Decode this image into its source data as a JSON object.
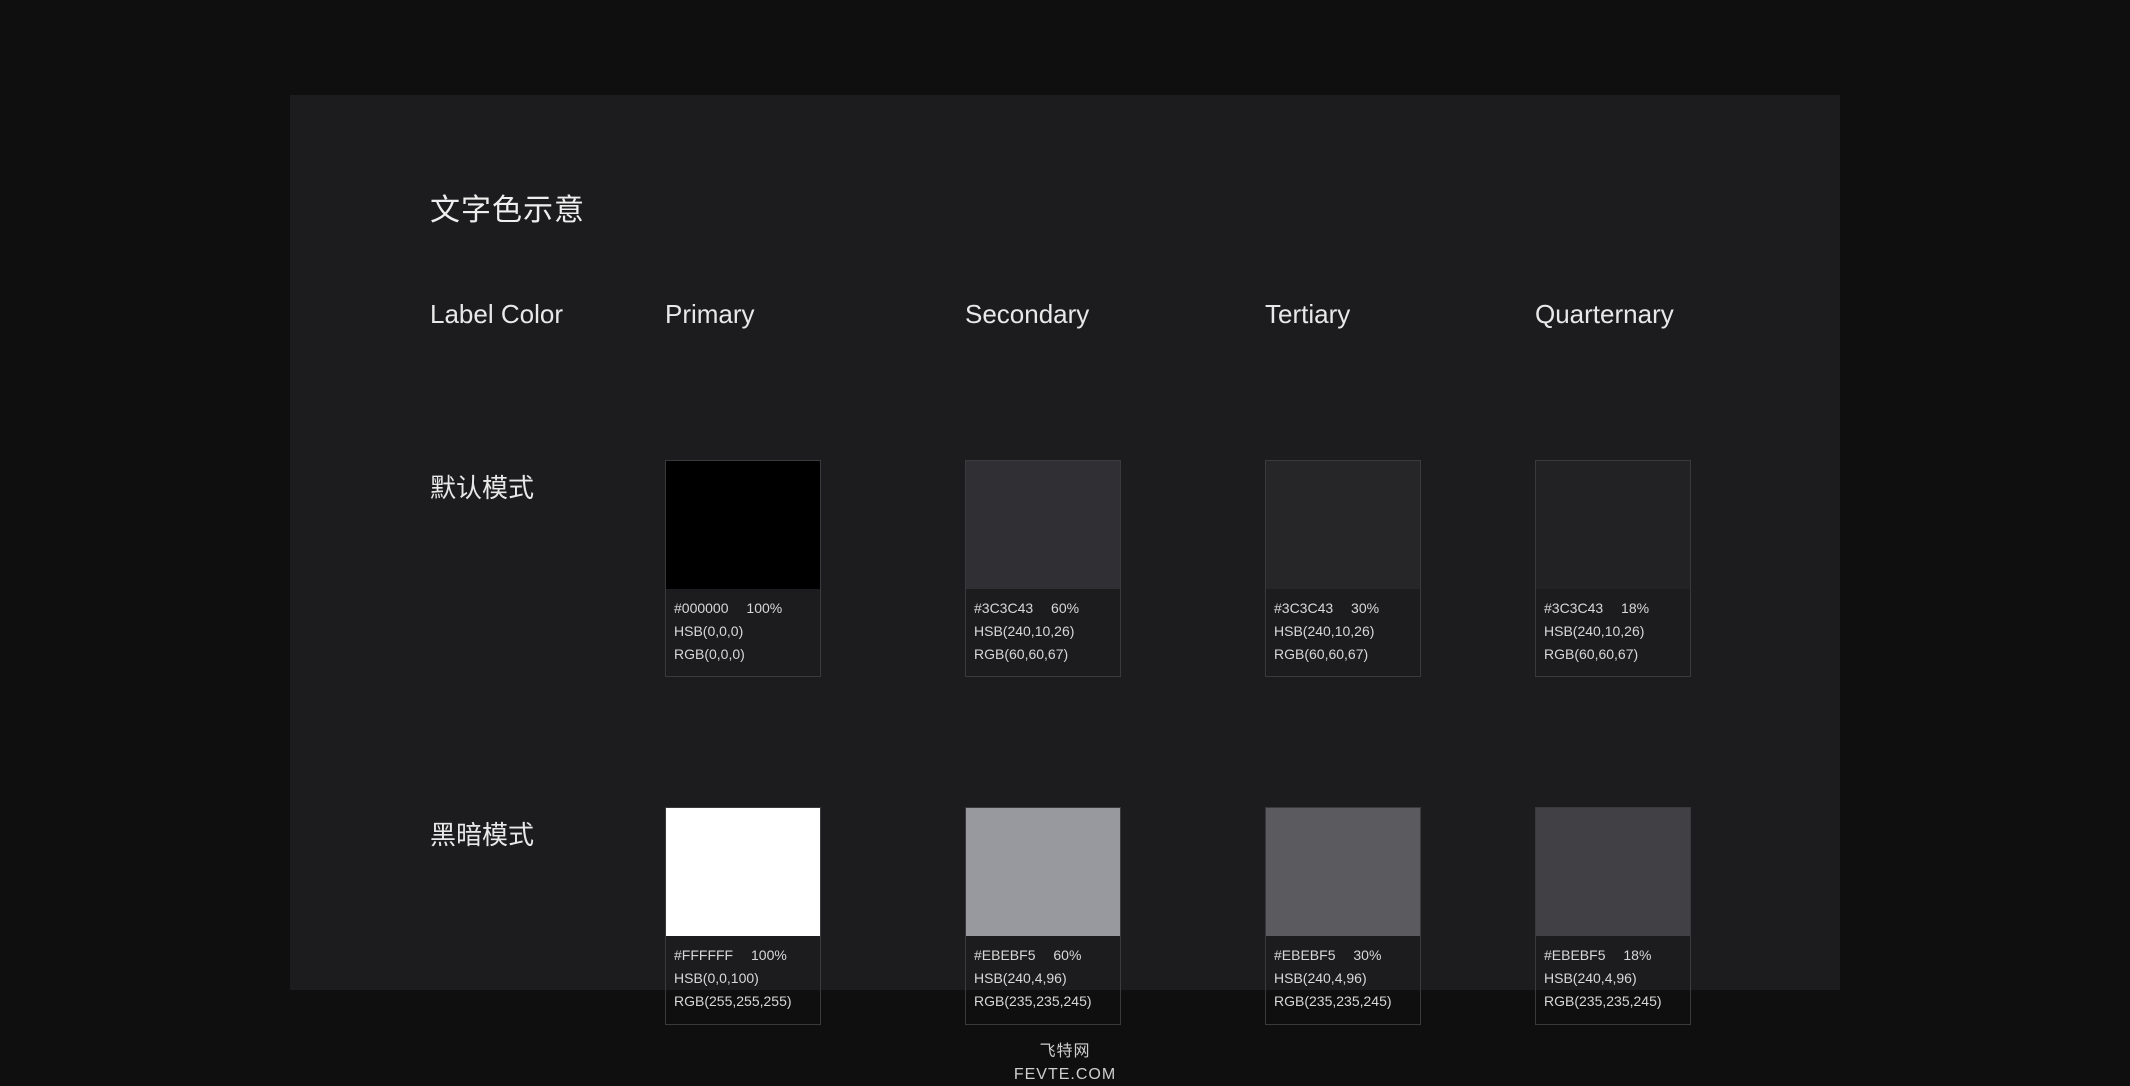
{
  "title": "文字色示意",
  "columns_header_label": "Label Color",
  "columns": [
    "Primary",
    "Secondary",
    "Tertiary",
    "Quarternary"
  ],
  "rows": [
    {
      "label": "默认模式",
      "swatches": [
        {
          "fill": "#000000",
          "opacity": 1.0,
          "hex": "#000000",
          "pct": "100%",
          "hsb": "HSB(0,0,0)",
          "rgb": "RGB(0,0,0)"
        },
        {
          "fill": "#3C3C43",
          "opacity": 0.6,
          "hex": "#3C3C43",
          "pct": "60%",
          "hsb": "HSB(240,10,26)",
          "rgb": "RGB(60,60,67)"
        },
        {
          "fill": "#3C3C43",
          "opacity": 0.3,
          "hex": "#3C3C43",
          "pct": "30%",
          "hsb": "HSB(240,10,26)",
          "rgb": "RGB(60,60,67)"
        },
        {
          "fill": "#3C3C43",
          "opacity": 0.18,
          "hex": "#3C3C43",
          "pct": "18%",
          "hsb": "HSB(240,10,26)",
          "rgb": "RGB(60,60,67)"
        }
      ]
    },
    {
      "label": "黑暗模式",
      "swatches": [
        {
          "fill": "#FFFFFF",
          "opacity": 1.0,
          "hex": "#FFFFFF",
          "pct": "100%",
          "hsb": "HSB(0,0,100)",
          "rgb": "RGB(255,255,255)"
        },
        {
          "fill": "#EBEBF5",
          "opacity": 0.6,
          "hex": "#EBEBF5",
          "pct": "60%",
          "hsb": "HSB(240,4,96)",
          "rgb": "RGB(235,235,245)"
        },
        {
          "fill": "#EBEBF5",
          "opacity": 0.3,
          "hex": "#EBEBF5",
          "pct": "30%",
          "hsb": "HSB(240,4,96)",
          "rgb": "RGB(235,235,245)"
        },
        {
          "fill": "#EBEBF5",
          "opacity": 0.18,
          "hex": "#EBEBF5",
          "pct": "18%",
          "hsb": "HSB(240,4,96)",
          "rgb": "RGB(235,235,245)"
        }
      ]
    }
  ],
  "footer": {
    "line1": "飞特网",
    "line2": "FEVTE.COM"
  }
}
